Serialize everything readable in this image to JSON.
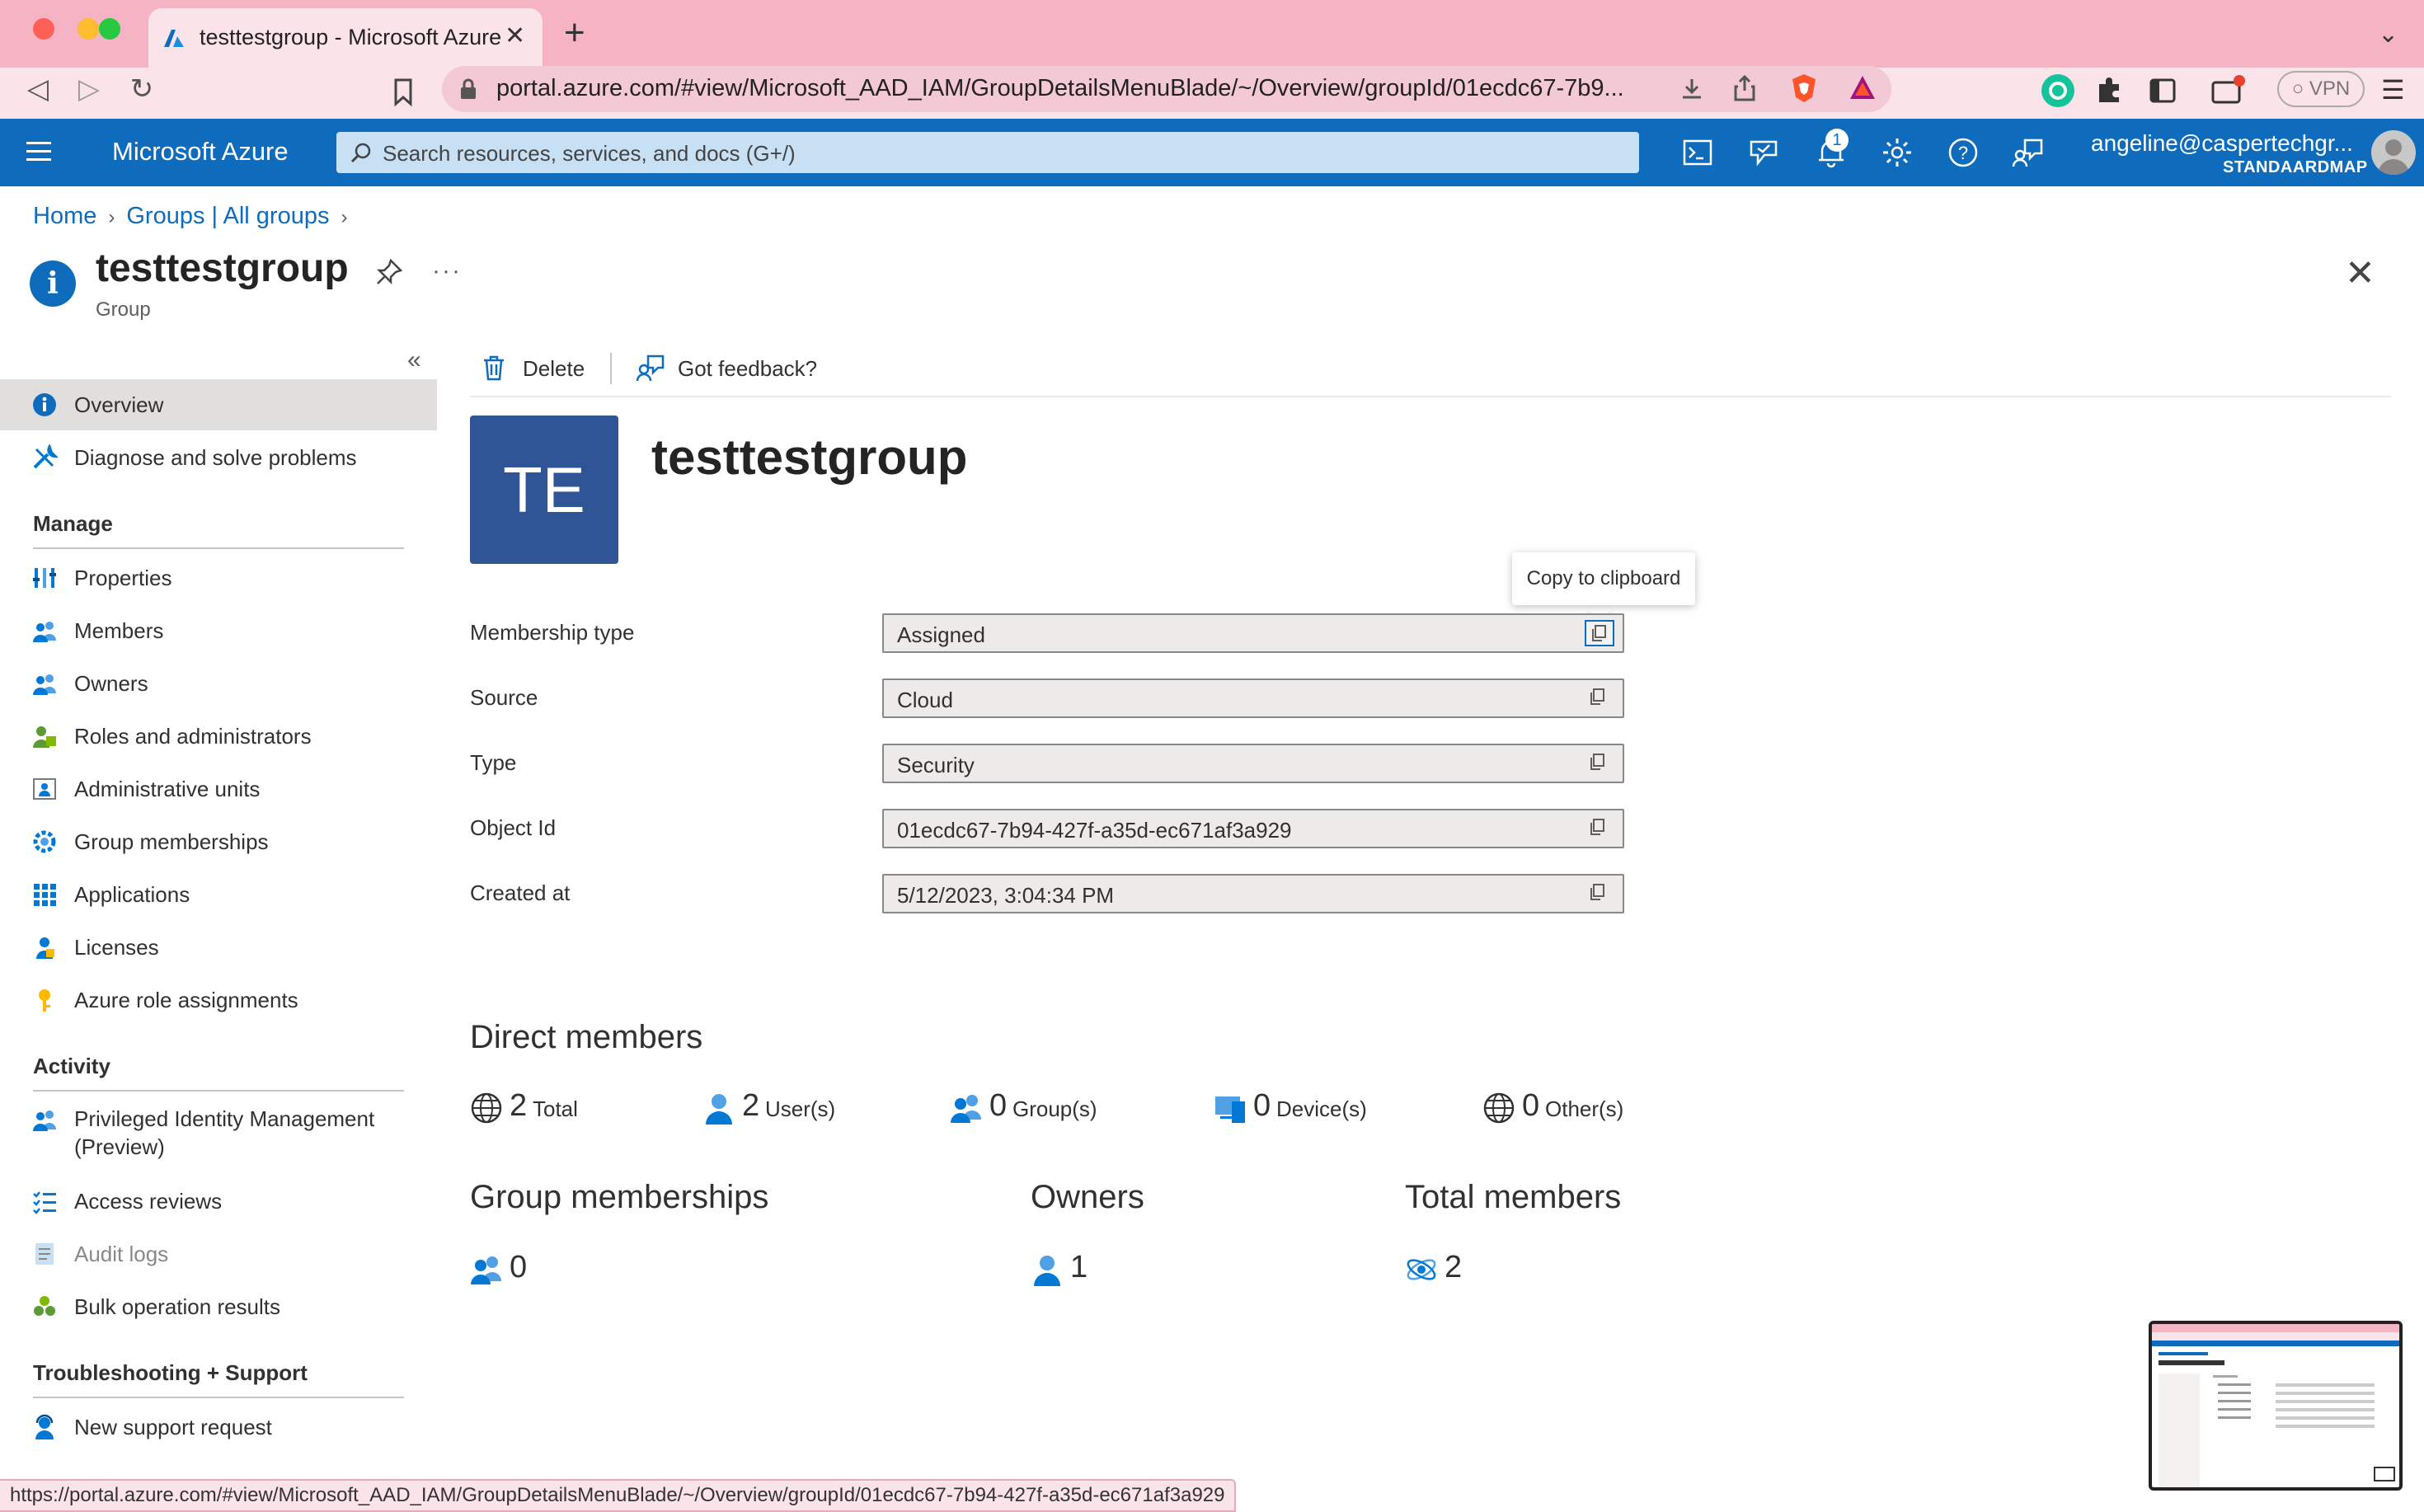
{
  "browser": {
    "tab_title": "testtestgroup - Microsoft Azure",
    "url": "portal.azure.com/#view/Microsoft_AAD_IAM/GroupDetailsMenuBlade/~/Overview/groupId/01ecdc67-7b9...",
    "vpn_label": "VPN",
    "status_url": "https://portal.azure.com/#view/Microsoft_AAD_IAM/GroupDetailsMenuBlade/~/Overview/groupId/01ecdc67-7b94-427f-a35d-ec671af3a929"
  },
  "azure": {
    "brand": "Microsoft Azure",
    "search_placeholder": "Search resources, services, and docs (G+/)",
    "notification_count": "1",
    "account_name": "angeline@caspertechgr...",
    "account_directory": "STANDAARDMAP",
    "brand_color": "#0f6cbd"
  },
  "breadcrumb": [
    "Home",
    "Groups | All groups"
  ],
  "header": {
    "title": "testtestgroup",
    "subtitle": "Group"
  },
  "sidebar": {
    "top_items": [
      {
        "label": "Overview",
        "icon": "info-icon",
        "selected": true
      },
      {
        "label": "Diagnose and solve problems",
        "icon": "wrench-icon"
      }
    ],
    "manage_title": "Manage",
    "manage_items": [
      {
        "label": "Properties",
        "icon": "properties-icon"
      },
      {
        "label": "Members",
        "icon": "members-icon"
      },
      {
        "label": "Owners",
        "icon": "owners-icon"
      },
      {
        "label": "Roles and administrators",
        "icon": "roles-icon"
      },
      {
        "label": "Administrative units",
        "icon": "admin-units-icon"
      },
      {
        "label": "Group memberships",
        "icon": "gear-people-icon"
      },
      {
        "label": "Applications",
        "icon": "grid-icon"
      },
      {
        "label": "Licenses",
        "icon": "license-icon"
      },
      {
        "label": "Azure role assignments",
        "icon": "key-icon"
      }
    ],
    "activity_title": "Activity",
    "activity_items": [
      {
        "label": "Privileged Identity Management",
        "label2": "(Preview)",
        "icon": "pim-icon"
      },
      {
        "label": "Access reviews",
        "icon": "checklist-icon"
      },
      {
        "label": "Audit logs",
        "icon": "log-icon",
        "dim": true
      },
      {
        "label": "Bulk operation results",
        "icon": "bulk-icon"
      }
    ],
    "support_title": "Troubleshooting + Support",
    "support_items": [
      {
        "label": "New support request",
        "icon": "support-person-icon"
      }
    ]
  },
  "commands": {
    "delete": "Delete",
    "feedback": "Got feedback?"
  },
  "group": {
    "initials": "TE",
    "name": "testtestgroup",
    "tile_color": "#2f5597"
  },
  "tooltip": "Copy to clipboard",
  "properties": [
    {
      "label": "Membership type",
      "value": "Assigned"
    },
    {
      "label": "Source",
      "value": "Cloud"
    },
    {
      "label": "Type",
      "value": "Security"
    },
    {
      "label": "Object Id",
      "value": "01ecdc67-7b94-427f-a35d-ec671af3a929"
    },
    {
      "label": "Created at",
      "value": "5/12/2023, 3:04:34 PM"
    }
  ],
  "direct_members": {
    "title": "Direct members",
    "stats": [
      {
        "count": "2",
        "label": "Total",
        "icon": "globe-icon"
      },
      {
        "count": "2",
        "label": "User(s)",
        "icon": "user-icon"
      },
      {
        "count": "0",
        "label": "Group(s)",
        "icon": "group-icon"
      },
      {
        "count": "0",
        "label": "Device(s)",
        "icon": "device-icon"
      },
      {
        "count": "0",
        "label": "Other(s)",
        "icon": "globe-icon"
      }
    ]
  },
  "summary": [
    {
      "title": "Group memberships",
      "value": "0",
      "icon": "group-icon"
    },
    {
      "title": "Owners",
      "value": "1",
      "icon": "user-icon"
    },
    {
      "title": "Total members",
      "value": "2",
      "icon": "members-orbit-icon"
    }
  ]
}
